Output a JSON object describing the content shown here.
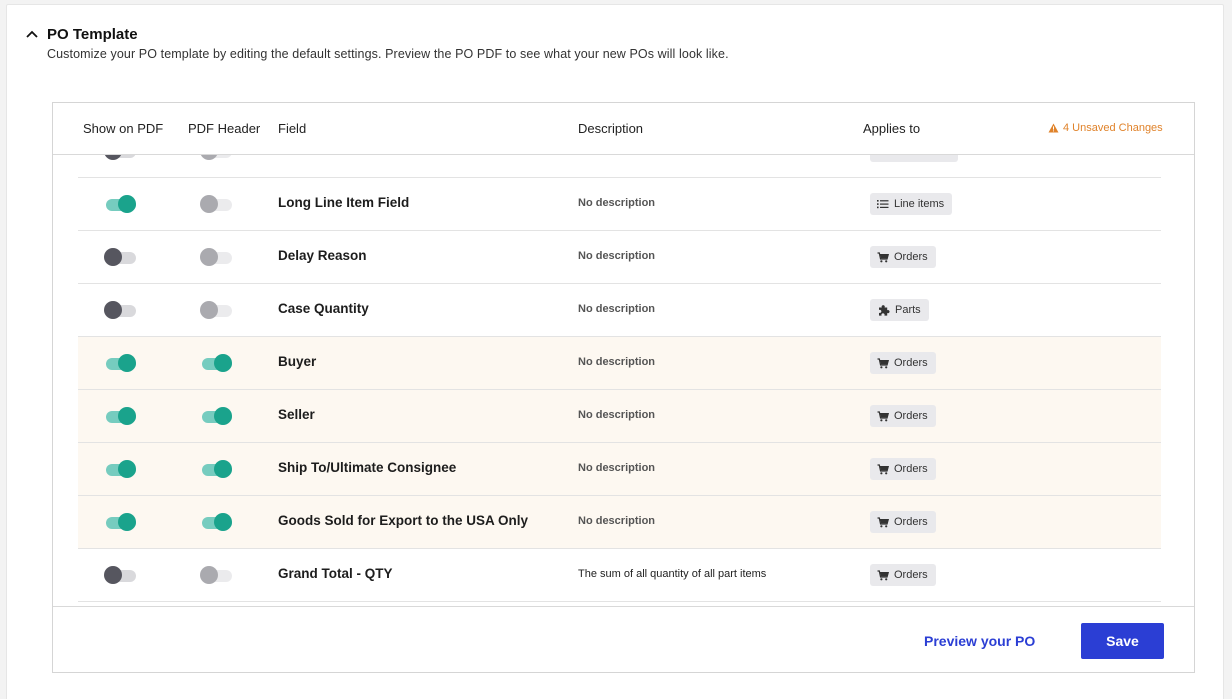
{
  "section": {
    "title": "PO Template",
    "subtitle": "Customize your PO template by editing the default settings. Preview the PO PDF to see what your new POs will look like."
  },
  "table": {
    "headers": {
      "show_on_pdf": "Show on PDF",
      "pdf_header": "PDF Header",
      "field": "Field",
      "description": "Description",
      "applies_to": "Applies to"
    },
    "unsaved_changes": "4 Unsaved Changes",
    "rows": [
      {
        "field": "Long Line Item Field",
        "description": "No description",
        "applies_to": "Line items",
        "applies_icon": "list-icon",
        "show_on_pdf": true,
        "pdf_header": false,
        "highlight": false
      },
      {
        "field": "Delay Reason",
        "description": "No description",
        "applies_to": "Orders",
        "applies_icon": "cart-icon",
        "show_on_pdf": false,
        "pdf_header": false,
        "highlight": false
      },
      {
        "field": "Case Quantity",
        "description": "No description",
        "applies_to": "Parts",
        "applies_icon": "puzzle-icon",
        "show_on_pdf": false,
        "pdf_header": false,
        "highlight": false
      },
      {
        "field": "Buyer",
        "description": "No description",
        "applies_to": "Orders",
        "applies_icon": "cart-icon",
        "show_on_pdf": true,
        "pdf_header": true,
        "highlight": true
      },
      {
        "field": "Seller",
        "description": "No description",
        "applies_to": "Orders",
        "applies_icon": "cart-icon",
        "show_on_pdf": true,
        "pdf_header": true,
        "highlight": true
      },
      {
        "field": "Ship To/Ultimate Consignee",
        "description": "No description",
        "applies_to": "Orders",
        "applies_icon": "cart-icon",
        "show_on_pdf": true,
        "pdf_header": true,
        "highlight": true
      },
      {
        "field": "Goods Sold for Export to the USA Only",
        "description": "No description",
        "applies_to": "Orders",
        "applies_icon": "cart-icon",
        "show_on_pdf": true,
        "pdf_header": true,
        "highlight": true
      },
      {
        "field": "Grand Total - QTY",
        "description": "The sum of all quantity of all part items",
        "applies_to": "Orders",
        "applies_icon": "cart-icon",
        "show_on_pdf": false,
        "pdf_header": false,
        "highlight": false
      }
    ]
  },
  "footer": {
    "preview_label": "Preview your PO",
    "save_label": "Save"
  },
  "colors": {
    "accent": "#2b3ed4",
    "toggle_on": "#1aa38c",
    "warning": "#e0832b",
    "highlight_row": "#fdf8f1"
  }
}
